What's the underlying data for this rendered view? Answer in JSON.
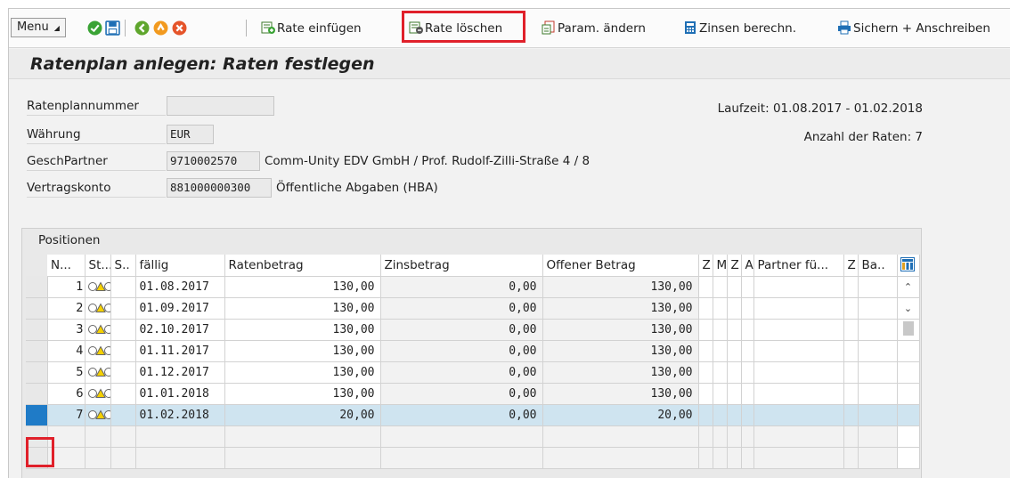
{
  "toolbar": {
    "menu_label": "Menu",
    "buttons": {
      "rate_einfuegen": "Rate einfügen",
      "rate_loeschen": "Rate löschen",
      "param_aendern": "Param. ändern",
      "zinsen_berechn": "Zinsen berechn.",
      "sichern_anschreiben": "Sichern + Anschreiben"
    },
    "icons": [
      "check-icon",
      "save-icon",
      "back-icon",
      "exit-icon",
      "cancel-icon",
      "rate-insert-icon",
      "rate-delete-icon",
      "param-change-icon",
      "calculator-icon",
      "print-icon"
    ]
  },
  "title": "Ratenplan anlegen: Raten festlegen",
  "form": {
    "ratenplannummer_label": "Ratenplannummer",
    "ratenplannummer_value": "",
    "waehrung_label": "Währung",
    "waehrung_value": "EUR",
    "geschpartner_label": "GeschPartner",
    "geschpartner_value": "9710002570",
    "geschpartner_text": "Comm-Unity EDV GmbH / Prof. Rudolf-Zilli-Straße 4 / 8",
    "vertragskonto_label": "Vertragskonto",
    "vertragskonto_value": "881000000300",
    "vertragskonto_text": "Öffentliche Abgaben (HBA)",
    "laufzeit": "Laufzeit: 01.08.2017 - 01.02.2018",
    "anzahl_raten": "Anzahl der Raten:  7"
  },
  "table": {
    "caption": "Positionen",
    "headers": {
      "n": "N...",
      "st": "St...",
      "s": "S..",
      "faellig": "fällig",
      "ratenbetrag": "Ratenbetrag",
      "zinsbetrag": "Zinsbetrag",
      "offener_betrag": "Offener Betrag",
      "z1": "Z",
      "m": "M",
      "z2": "Z",
      "a": "A",
      "partner": "Partner fü...",
      "z3": "Z",
      "ba": "Ba.."
    },
    "rows": [
      {
        "n": "1",
        "faellig": "01.08.2017",
        "ratenbetrag": "130,00",
        "zinsbetrag": "0,00",
        "offener_betrag": "130,00"
      },
      {
        "n": "2",
        "faellig": "01.09.2017",
        "ratenbetrag": "130,00",
        "zinsbetrag": "0,00",
        "offener_betrag": "130,00"
      },
      {
        "n": "3",
        "faellig": "02.10.2017",
        "ratenbetrag": "130,00",
        "zinsbetrag": "0,00",
        "offener_betrag": "130,00"
      },
      {
        "n": "4",
        "faellig": "01.11.2017",
        "ratenbetrag": "130,00",
        "zinsbetrag": "0,00",
        "offener_betrag": "130,00"
      },
      {
        "n": "5",
        "faellig": "01.12.2017",
        "ratenbetrag": "130,00",
        "zinsbetrag": "0,00",
        "offener_betrag": "130,00"
      },
      {
        "n": "6",
        "faellig": "01.01.2018",
        "ratenbetrag": "130,00",
        "zinsbetrag": "0,00",
        "offener_betrag": "130,00"
      },
      {
        "n": "7",
        "faellig": "01.02.2018",
        "ratenbetrag": "20,00",
        "zinsbetrag": "0,00",
        "offener_betrag": "20,00",
        "selected": true
      }
    ],
    "scroll": {
      "up": "⌃",
      "down": "⌄"
    }
  },
  "colors": {
    "highlight": "#e0202a",
    "selected_row": "#cfe4f0",
    "selector_active": "#1f7bc7"
  }
}
